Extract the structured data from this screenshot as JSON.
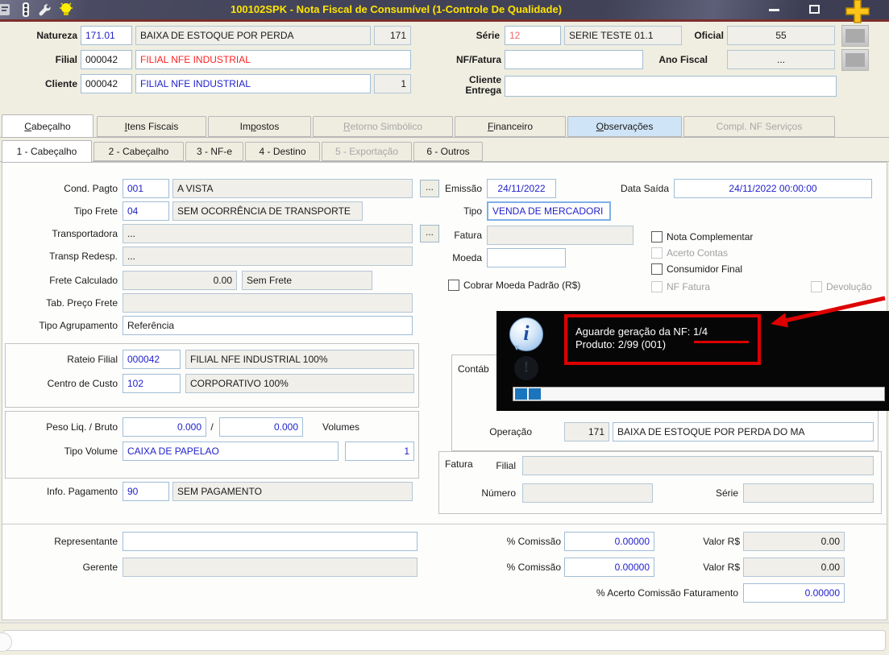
{
  "window": {
    "title": "100102SPK - Nota Fiscal de Consumível (1-Controle De Qualidade)"
  },
  "ui": {
    "ellipsis": "..."
  },
  "header": {
    "natureza": {
      "label": "Natureza",
      "code": "171.01",
      "desc": "BAIXA DE ESTOQUE POR PERDA",
      "extra": "171"
    },
    "serie": {
      "label": "Série",
      "code": "12",
      "desc": "SERIE TESTE 01.1"
    },
    "oficial": {
      "label": "Oficial",
      "value": "55"
    },
    "filial": {
      "label": "Filial",
      "code": "000042",
      "desc": "FILIAL NFE INDUSTRIAL"
    },
    "nf_fatura": {
      "label": "NF/Fatura",
      "value": ""
    },
    "ano_fiscal": {
      "label": "Ano Fiscal",
      "value": "..."
    },
    "cliente": {
      "label": "Cliente",
      "code": "000042",
      "desc": "FILIAL NFE INDUSTRIAL",
      "extra": "1"
    },
    "cliente_entrega": {
      "label": "Cliente Entrega",
      "value": ""
    }
  },
  "tabs": {
    "main": [
      {
        "pre": "",
        "key": "C",
        "post": "abeçalho",
        "state": "active"
      },
      {
        "pre": "",
        "key": "I",
        "post": "tens Fiscais",
        "state": "normal"
      },
      {
        "pre": "Im",
        "key": "p",
        "post": "ostos",
        "state": "normal"
      },
      {
        "pre": "",
        "key": "R",
        "post": "etorno Simbólico",
        "state": "disabled"
      },
      {
        "pre": "",
        "key": "F",
        "post": "inanceiro",
        "state": "normal"
      },
      {
        "pre": "",
        "key": "O",
        "post": "bservações",
        "state": "highlight"
      },
      {
        "pre": "",
        "key": "",
        "post": "Compl. NF Serviços",
        "state": "disabled"
      }
    ],
    "sub": [
      {
        "label": "1 - Cabeçalho",
        "state": "active"
      },
      {
        "label": "2 - Cabeçalho",
        "state": "normal"
      },
      {
        "label": "3 - NF-e",
        "state": "normal"
      },
      {
        "label": "4 - Destino",
        "state": "normal"
      },
      {
        "label": "5 - Exportação",
        "state": "disabled"
      },
      {
        "label": "6 - Outros",
        "state": "normal"
      }
    ]
  },
  "left": {
    "cond_pagto": {
      "label": "Cond. Pagto",
      "code": "001",
      "desc": "A VISTA"
    },
    "tipo_frete": {
      "label": "Tipo Frete",
      "code": "04",
      "desc": "SEM OCORRÊNCIA DE TRANSPORTE"
    },
    "transportadora": {
      "label": "Transportadora",
      "value": "..."
    },
    "transp_redesp": {
      "label": "Transp Redesp.",
      "value": "..."
    },
    "frete_calculado": {
      "label": "Frete Calculado",
      "value": "0.00",
      "select": "Sem Frete"
    },
    "tab_preco_frete": {
      "label": "Tab. Preço Frete",
      "value": ""
    },
    "tipo_agrupamento": {
      "label": "Tipo Agrupamento",
      "select": "Referência"
    },
    "rateio_filial": {
      "label": "Rateio Filial",
      "code": "000042",
      "desc": "FILIAL NFE INDUSTRIAL 100%"
    },
    "centro_custo": {
      "label": "Centro de Custo",
      "code": "102",
      "desc": "CORPORATIVO 100%"
    },
    "peso": {
      "label": "Peso Liq. / Bruto",
      "liq": "0.000",
      "sep": "/",
      "bruto": "0.000",
      "volumes_label": "Volumes"
    },
    "tipo_volume": {
      "label": "Tipo Volume",
      "value": "CAIXA DE PAPELAO",
      "volumes": "1"
    },
    "info_pagamento": {
      "label": "Info. Pagamento",
      "code": "90",
      "desc": "SEM PAGAMENTO"
    }
  },
  "middle": {
    "emissao": {
      "label": "Emissão",
      "value": "24/11/2022"
    },
    "data_saida": {
      "label": "Data Saída",
      "value": "24/11/2022 00:00:00"
    },
    "tipo": {
      "label": "Tipo",
      "value": "VENDA DE MERCADORI"
    },
    "fatura": {
      "label": "Fatura",
      "value": ""
    },
    "moeda": {
      "label": "Moeda",
      "value": ""
    },
    "checks": {
      "nota_complementar": "Nota Complementar",
      "acerto_contas": "Acerto Contas",
      "consumidor_final": "Consumidor Final",
      "nf_fatura": "NF Fatura",
      "devolucao": "Devolução",
      "cobrar_moeda": "Cobrar Moeda Padrão (R$)"
    },
    "contab": "Contáb",
    "operacao": {
      "label": "Operação",
      "code": "171",
      "desc": "BAIXA DE ESTOQUE POR PERDA DO MA"
    },
    "fatura_group": {
      "title": "Fatura",
      "filial": "Filial",
      "numero": "Número",
      "serie": "Série"
    }
  },
  "bottom": {
    "representante": {
      "label": "Representante",
      "value": ""
    },
    "gerente": {
      "label": "Gerente",
      "value": ""
    },
    "comissao1": {
      "label": "% Comissão",
      "value": "0.00000",
      "valor_label": "Valor R$",
      "valor": "0.00"
    },
    "comissao2": {
      "label": "% Comissão",
      "value": "0.00000",
      "valor_label": "Valor R$",
      "valor": "0.00"
    },
    "acerto_comissao": {
      "label": "% Acerto Comissão Faturamento",
      "value": "0.00000"
    }
  },
  "popup": {
    "line1": "Aguarde geração da NF: 1/4",
    "line2": "Produto: 2/99 (001)"
  },
  "colors": {
    "title_text": "#ffe400",
    "value_blue": "#2222cc",
    "alert_red": "#ff2222",
    "annotation": "#dd0000",
    "progress": "#1b75bc"
  }
}
